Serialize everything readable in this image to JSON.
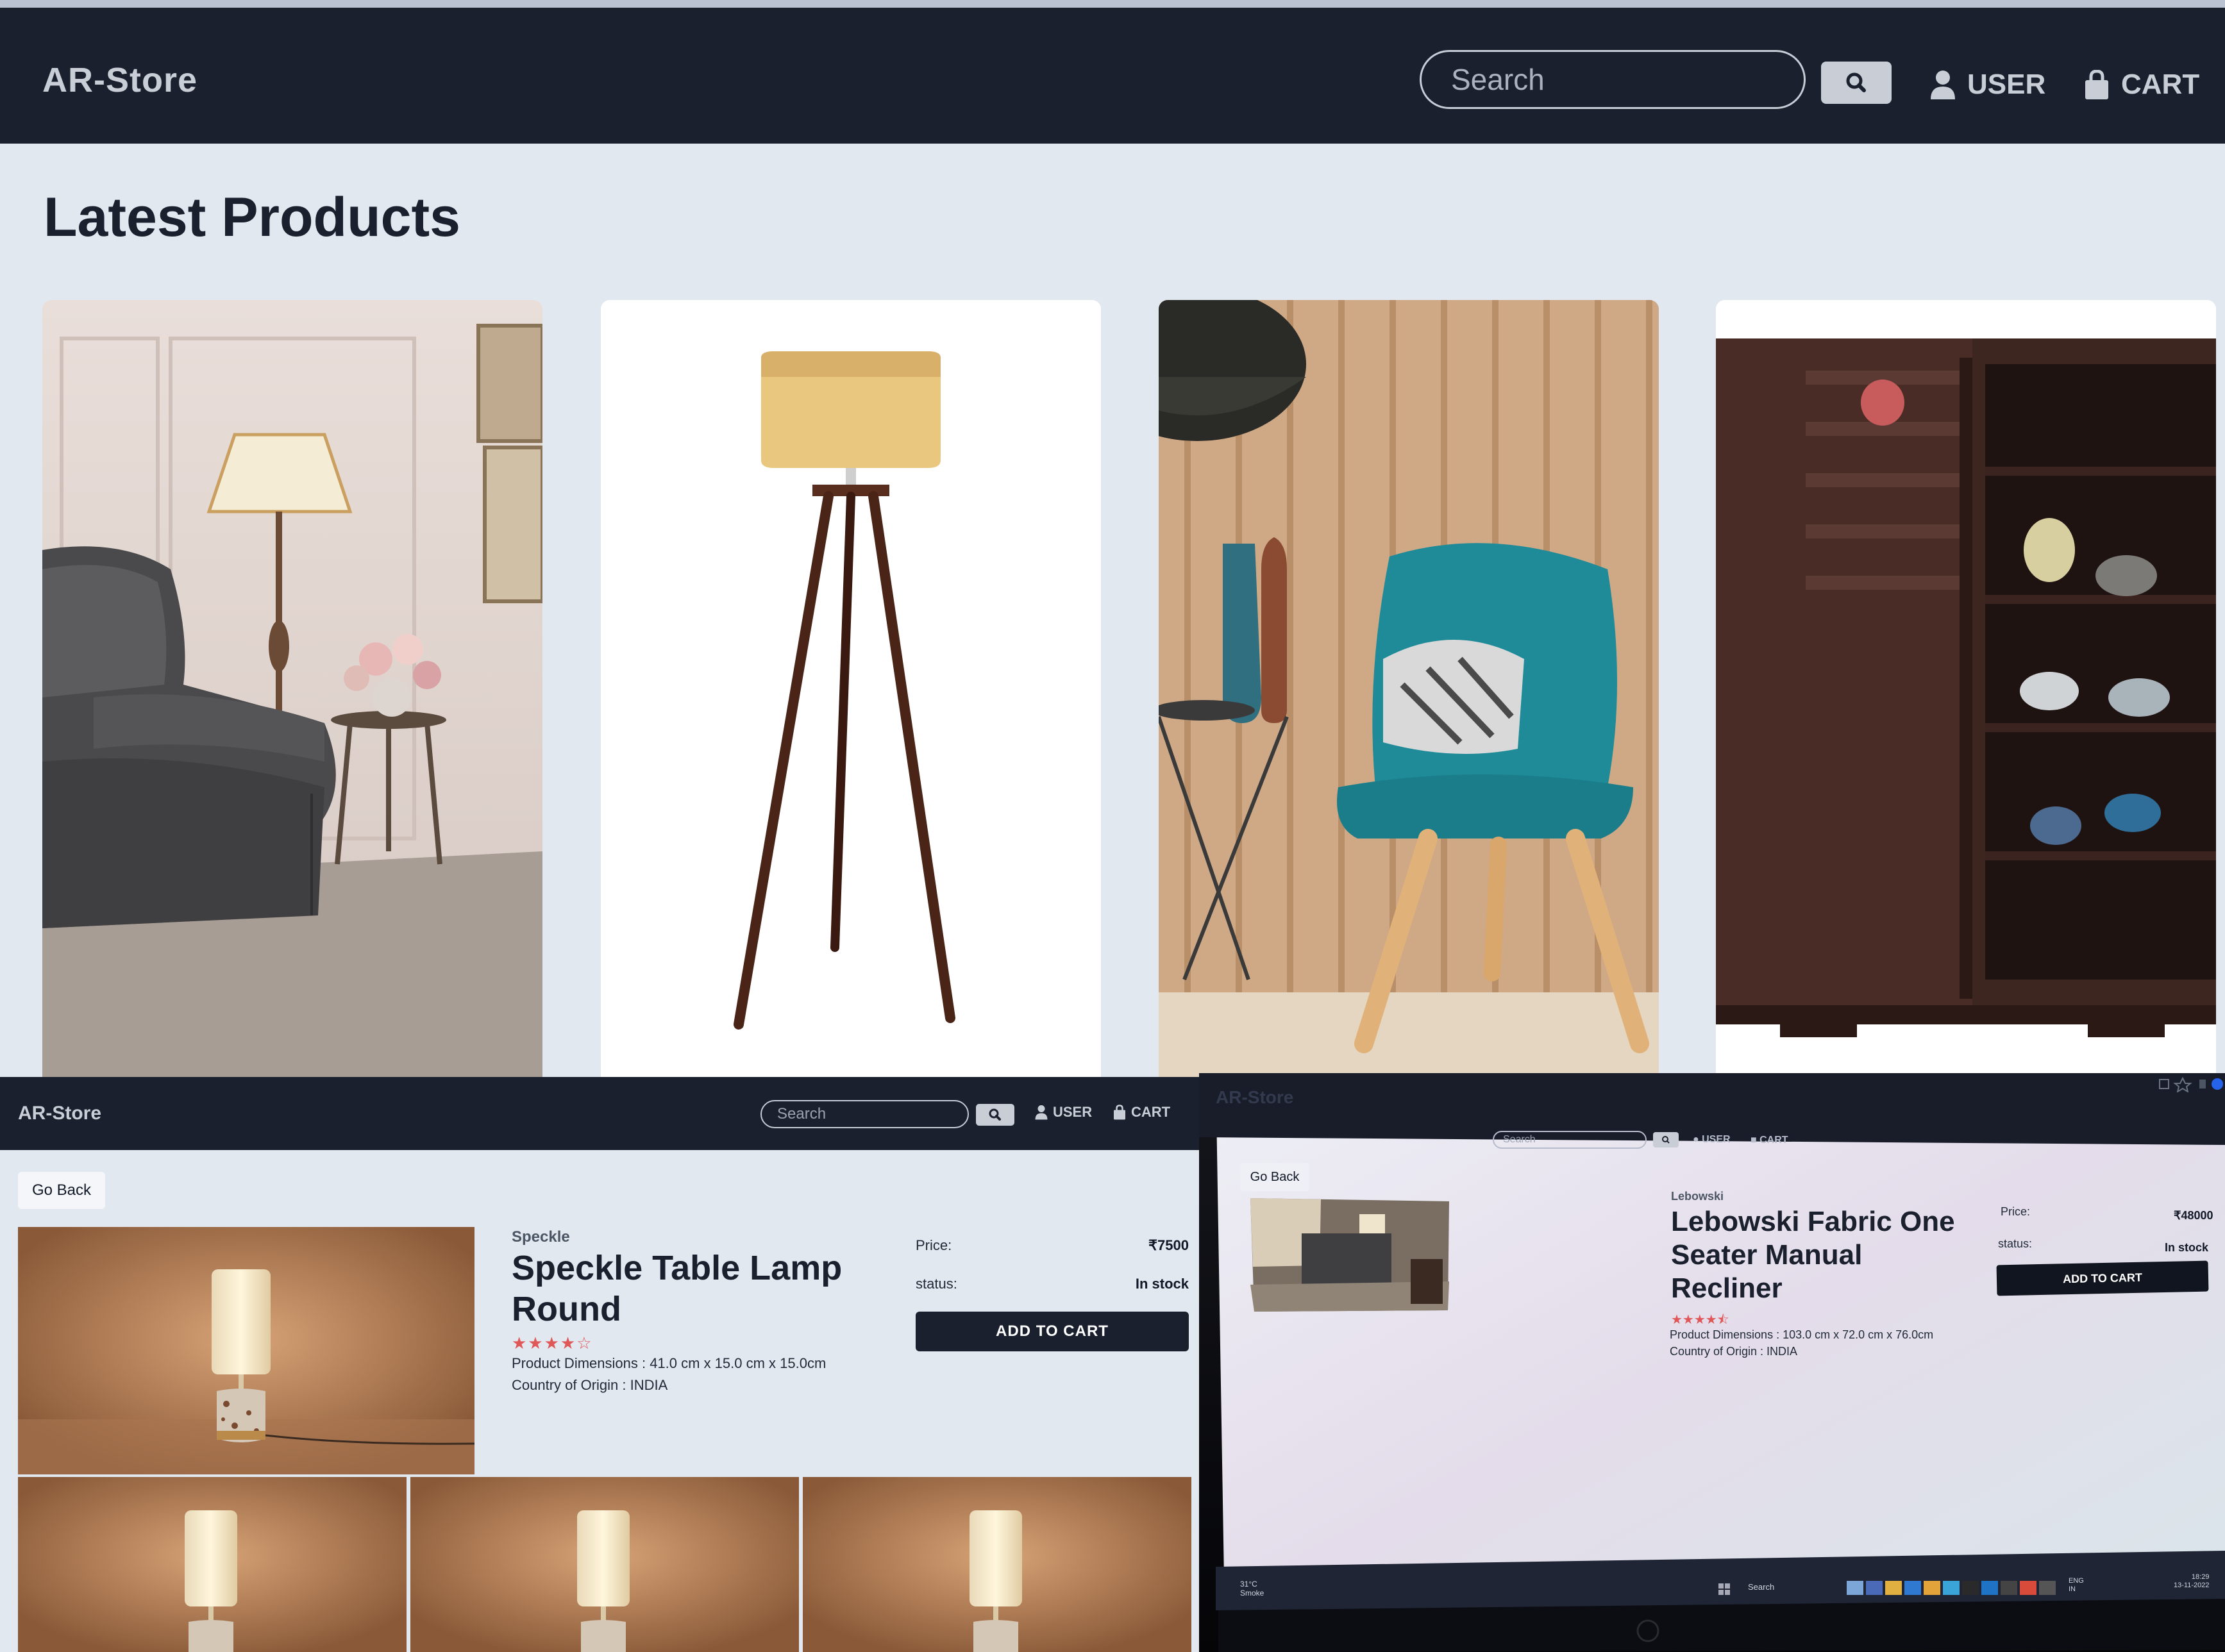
{
  "store": {
    "brand": "AR-Store",
    "search_placeholder": "Search",
    "user_label": "USER",
    "cart_label": "CART"
  },
  "home": {
    "heading": "Latest Products",
    "products": [
      {
        "image": "grey recliner chair with floor lamp"
      },
      {
        "image": "tripod floor lamp"
      },
      {
        "image": "teal chair with cushion"
      },
      {
        "image": "dark wooden shoe cabinet"
      }
    ]
  },
  "detail_lamp": {
    "go_back": "Go Back",
    "brand": "Speckle",
    "title": "Speckle Table Lamp Round",
    "rating_stars": "★★★★☆",
    "rating": 4,
    "dimensions": "Product Dimensions : 41.0 cm x 15.0 cm x 15.0cm",
    "origin": "Country of Origin : INDIA",
    "price_label": "Price:",
    "price_value": "₹7500",
    "status_label": "status:",
    "status_value": "In stock",
    "add_to_cart": "ADD TO CART"
  },
  "detail_recliner": {
    "go_back": "Go Back",
    "brand": "Lebowski",
    "title": "Lebowski Fabric One Seater Manual Recliner",
    "rating_stars": "★★★★⯪",
    "rating": 4.5,
    "dimensions": "Product Dimensions : 103.0 cm x 72.0 cm x 76.0cm",
    "origin": "Country of Origin : INDIA",
    "price_label": "Price:",
    "price_value": "₹48000",
    "status_label": "status:",
    "status_value": "In stock",
    "add_to_cart": "ADD TO CART",
    "taskbar": {
      "weather_temp": "31°C",
      "weather_text": "Smoke",
      "search_label": "Search",
      "lang_top": "ENG",
      "lang_bottom": "IN",
      "time": "18:29",
      "date": "13-11-2022"
    }
  },
  "colors": {
    "nav_bg": "#1a202e",
    "page_bg": "#e2e8f0",
    "star": "#e05757"
  }
}
